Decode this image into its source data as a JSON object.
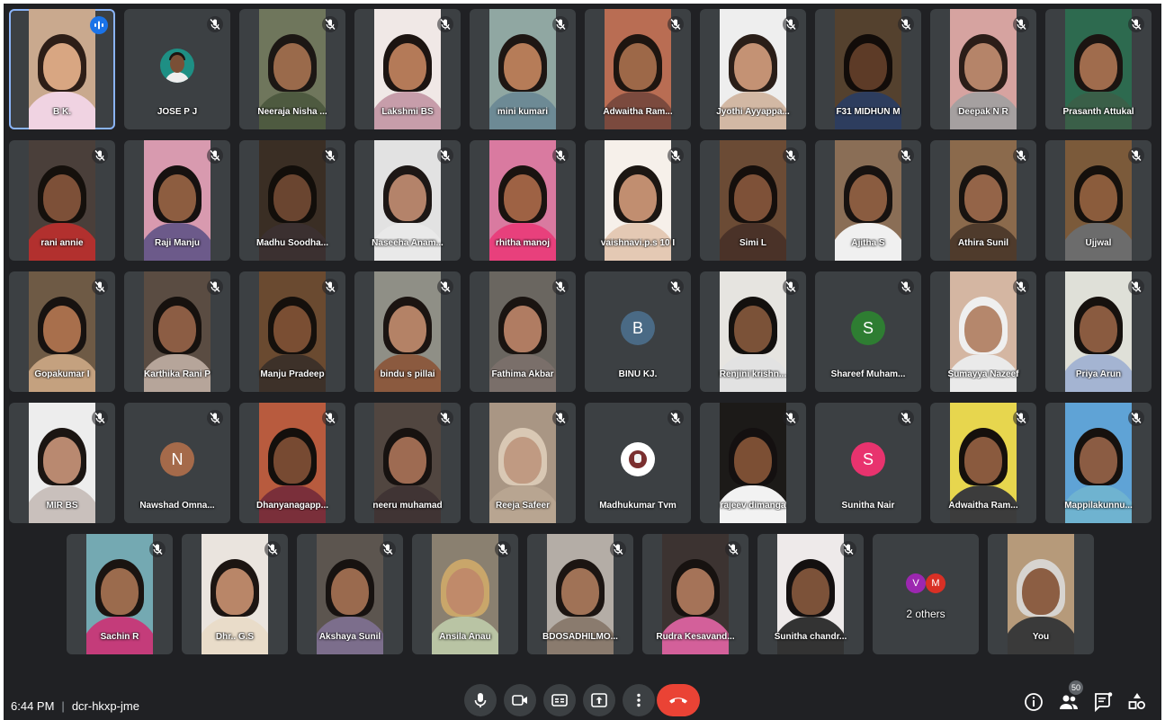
{
  "meeting": {
    "time": "6:44 PM",
    "code": "dcr-hkxp-jme",
    "participant_count": "50"
  },
  "rows": [
    [
      {
        "name": "B   K.",
        "kind": "video",
        "bg": "#c9a98e",
        "skin": "#d8a682",
        "hair": "#2d1e17",
        "cloth": "#f0d3e2",
        "speaking": true
      },
      {
        "name": "JOSE P J",
        "kind": "photo",
        "bg": "#3c4043",
        "skin": "#7a4f36",
        "hair": "#1b1410",
        "cloth": "#1e8f84"
      },
      {
        "name": "Neeraja Nisha ...",
        "kind": "video",
        "bg": "#6f765c",
        "skin": "#9a6a4b",
        "hair": "#1c1714",
        "cloth": "#4e5a40"
      },
      {
        "name": "Lakshmi BS",
        "kind": "video",
        "bg": "#f0e8e6",
        "skin": "#b47a58",
        "hair": "#1c1411",
        "cloth": "#c79daa"
      },
      {
        "name": "mini kumari",
        "kind": "video",
        "bg": "#90a7a2",
        "skin": "#b67c58",
        "hair": "#1e1613",
        "cloth": "#6d8a95"
      },
      {
        "name": "Adwaitha Ram...",
        "kind": "video",
        "bg": "#b96d53",
        "skin": "#9d6848",
        "hair": "#1e1510",
        "cloth": "#7b4a3e"
      },
      {
        "name": "Jyothi Ayyappa...",
        "kind": "video",
        "bg": "#eeeeee",
        "skin": "#c49274",
        "hair": "#2a1e18",
        "cloth": "#d2b8a4"
      },
      {
        "name": "F31 MIDHUN M",
        "kind": "video",
        "bg": "#54412e",
        "skin": "#5d3b27",
        "hair": "#120c09",
        "cloth": "#2d3d5e"
      },
      {
        "name": "Deepak N R",
        "kind": "video",
        "bg": "#d6a3a0",
        "skin": "#b58469",
        "hair": "#2b1d18",
        "cloth": "#a5a0a0"
      },
      {
        "name": "Prasanth Attukal",
        "kind": "video",
        "bg": "#2d6a4f",
        "skin": "#a06c4d",
        "hair": "#1b1411",
        "cloth": "#3a5f48"
      }
    ],
    [
      {
        "name": "rani annie",
        "kind": "video",
        "bg": "#4a3f3a",
        "skin": "#7d5038",
        "hair": "#15100c",
        "cloth": "#b2302e"
      },
      {
        "name": "Raji Manju",
        "kind": "video",
        "bg": "#d89aaf",
        "skin": "#8d5d40",
        "hair": "#161110",
        "cloth": "#6c5a8a"
      },
      {
        "name": "Madhu Soodha...",
        "kind": "video",
        "bg": "#3a2e24",
        "skin": "#6a4530",
        "hair": "#120e0a",
        "cloth": "#3b3030"
      },
      {
        "name": "Naseeha Anam...",
        "kind": "video",
        "bg": "#e2e2e2",
        "skin": "#b4836a",
        "hair": "#1d1715",
        "cloth": "#e9e9e9"
      },
      {
        "name": "rhitha manoj",
        "kind": "video",
        "bg": "#d97aa0",
        "skin": "#9e6244",
        "hair": "#1a1310",
        "cloth": "#e8407c"
      },
      {
        "name": "vaishnavi.p.s 10 I",
        "kind": "video",
        "bg": "#f6f0ea",
        "skin": "#c18e70",
        "hair": "#1c1612",
        "cloth": "#e4c9b4"
      },
      {
        "name": "Simi L",
        "kind": "video",
        "bg": "#6b4b35",
        "skin": "#7e5138",
        "hair": "#150f0c",
        "cloth": "#4a3228"
      },
      {
        "name": "Ajitha S",
        "kind": "video",
        "bg": "#8a6e56",
        "skin": "#8a5c40",
        "hair": "#171210",
        "cloth": "#f0f0f0"
      },
      {
        "name": "Athira Sunil",
        "kind": "video",
        "bg": "#8b6a4c",
        "skin": "#946448",
        "hair": "#181310",
        "cloth": "#4f3b2c"
      },
      {
        "name": "Ujjwal",
        "kind": "video",
        "bg": "#7b5a3a",
        "skin": "#8b5c3c",
        "hair": "#15100c",
        "cloth": "#6c6c6c"
      }
    ],
    [
      {
        "name": "Gopakumar I",
        "kind": "video",
        "bg": "#6e5a45",
        "skin": "#a86f4c",
        "hair": "#171210",
        "cloth": "#c4a17f"
      },
      {
        "name": "Karthika Rani P",
        "kind": "video",
        "bg": "#5a4c42",
        "skin": "#8c5d44",
        "hair": "#16110e",
        "cloth": "#b6a59a"
      },
      {
        "name": "Manju Pradeep",
        "kind": "video",
        "bg": "#6a4a30",
        "skin": "#7a4e33",
        "hair": "#15100c",
        "cloth": "#3d3129"
      },
      {
        "name": "bindu s pillai",
        "kind": "video",
        "bg": "#8f8f86",
        "skin": "#b48266",
        "hair": "#1b1411",
        "cloth": "#8b5a3f"
      },
      {
        "name": "Fathima Akbar",
        "kind": "video",
        "bg": "#6a6660",
        "skin": "#b07c62",
        "hair": "#1a1411",
        "cloth": "#7a6f6a"
      },
      {
        "name": "BINU KJ.",
        "kind": "avatar",
        "letter": "B",
        "color": "#4a6a85"
      },
      {
        "name": "Renjini krishn...",
        "kind": "video",
        "bg": "#e6e4e0",
        "skin": "#7b5238",
        "hair": "#13100e",
        "cloth": "#e2e2e2"
      },
      {
        "name": "Shareef Muham...",
        "kind": "avatar",
        "letter": "S",
        "color": "#2e7d32"
      },
      {
        "name": "Sumayya Nazeef",
        "kind": "video",
        "bg": "#d4b6a2",
        "skin": "#b5876c",
        "hair": "#efefef",
        "cloth": "#eaeaea"
      },
      {
        "name": "Priya Arun",
        "kind": "video",
        "bg": "#dfe0d8",
        "skin": "#8a5b40",
        "hair": "#16110e",
        "cloth": "#a4b4d2"
      }
    ],
    [
      {
        "name": "MIR BS",
        "kind": "video",
        "bg": "#ededed",
        "skin": "#b98970",
        "hair": "#1b1512",
        "cloth": "#c9c0bc"
      },
      {
        "name": "Nawshad Omna...",
        "kind": "avatar",
        "letter": "N",
        "color": "#a56a4a"
      },
      {
        "name": "Dhanyanagapp...",
        "kind": "video",
        "bg": "#b85b3e",
        "skin": "#774a32",
        "hair": "#130f0c",
        "cloth": "#7a2f3a"
      },
      {
        "name": "neeru muhamad",
        "kind": "video",
        "bg": "#514640",
        "skin": "#9e6b52",
        "hair": "#171210",
        "cloth": "#403434"
      },
      {
        "name": "Reeja Safeer",
        "kind": "video",
        "bg": "#a99684",
        "skin": "#c09a82",
        "hair": "#d9c8b4",
        "cloth": "#b8a591"
      },
      {
        "name": "Madhukumar Tvm",
        "kind": "logo",
        "color": "#ffffff"
      },
      {
        "name": "rajeev dimanga",
        "kind": "video",
        "bg": "#1c1a18",
        "skin": "#7c4f34",
        "hair": "#141010",
        "cloth": "#f2f2f2"
      },
      {
        "name": "Sunitha Nair",
        "kind": "avatar",
        "letter": "S",
        "color": "#e8336e"
      },
      {
        "name": "Adwaitha Ram...",
        "kind": "video",
        "bg": "#e7d64e",
        "skin": "#8a5a3e",
        "hair": "#15100c",
        "cloth": "#3c3c3c"
      },
      {
        "name": "Mappilakunnu...",
        "kind": "video",
        "bg": "#5fa3d6",
        "skin": "#8b5c43",
        "hair": "#16110e",
        "cloth": "#6fb3d0"
      }
    ],
    [
      {
        "name": "Sachin R",
        "kind": "video",
        "bg": "#74a9b2",
        "skin": "#9b6b4d",
        "hair": "#1a1411",
        "cloth": "#c43c7a"
      },
      {
        "name": "Dhr.. G.S",
        "kind": "video",
        "bg": "#eae4de",
        "skin": "#b98668",
        "hair": "#1c1512",
        "cloth": "#e9dcc9"
      },
      {
        "name": "Akshaya Sunil",
        "kind": "video",
        "bg": "#5c554f",
        "skin": "#9a6a4e",
        "hair": "#171210",
        "cloth": "#7c6e8c"
      },
      {
        "name": "Ansila Anau",
        "kind": "video",
        "bg": "#8a8070",
        "skin": "#c08a6a",
        "hair": "#c9a66a",
        "cloth": "#b9c4a4"
      },
      {
        "name": "BDOSADHILMO...",
        "kind": "video",
        "bg": "#b4ada6",
        "skin": "#a07256",
        "hair": "#1c1512",
        "cloth": "#8a7b6e"
      },
      {
        "name": "Rudra Kesavand...",
        "kind": "video",
        "bg": "#3c3331",
        "skin": "#a57358",
        "hair": "#171210",
        "cloth": "#d3609a"
      },
      {
        "name": "Sunitha chandr...",
        "kind": "video",
        "bg": "#eeeaea",
        "skin": "#7c5239",
        "hair": "#141010",
        "cloth": "#333333"
      },
      {
        "name": "2 others",
        "kind": "others",
        "letters": [
          "V",
          "M"
        ],
        "colors": [
          "#9c27b0",
          "#d93025"
        ]
      },
      {
        "name": "You",
        "kind": "video",
        "bg": "#b69a7a",
        "skin": "#8c5e43",
        "hair": "#d7d4d0",
        "cloth": "#3a3a3a"
      }
    ]
  ]
}
